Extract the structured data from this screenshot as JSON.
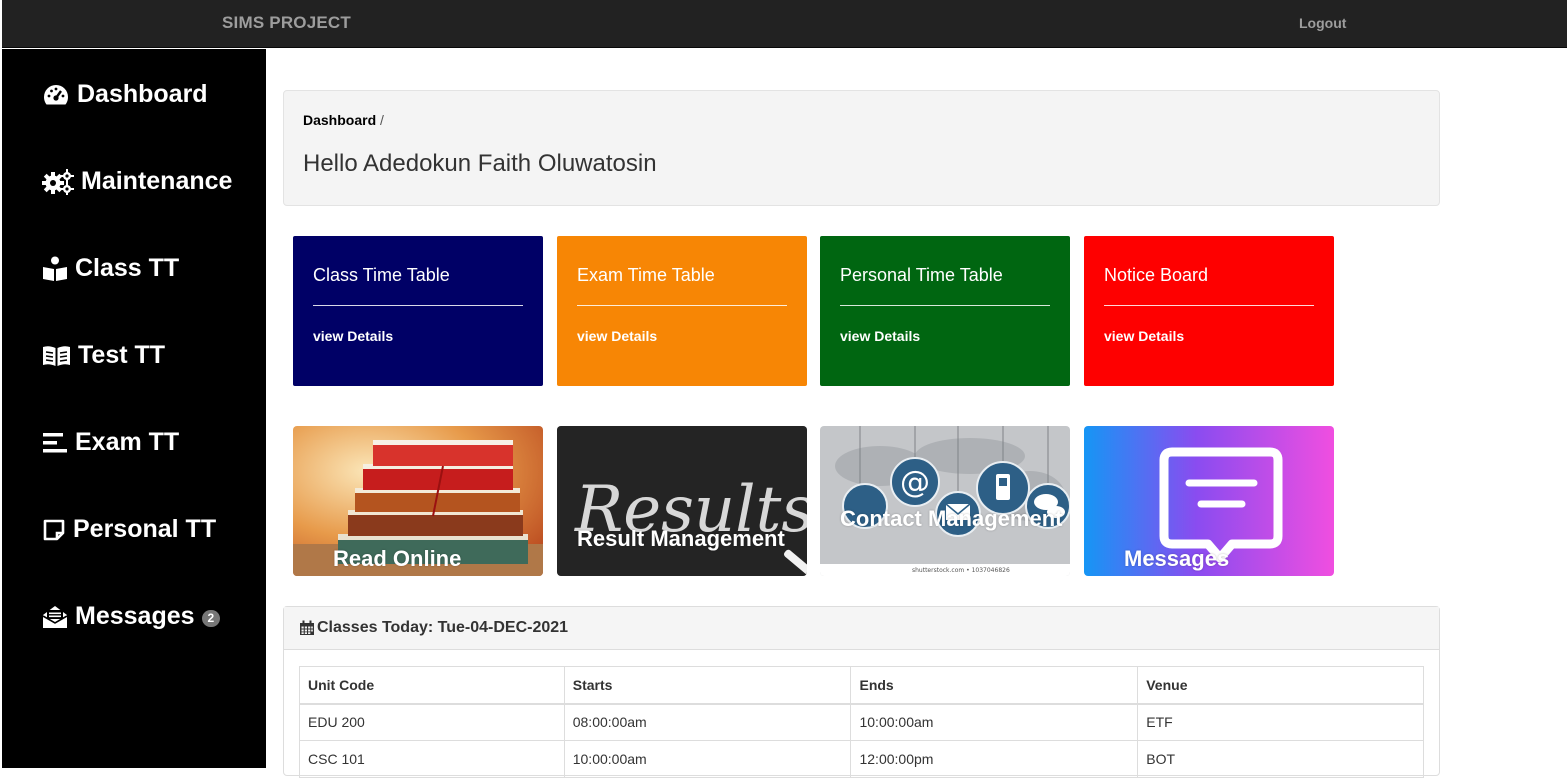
{
  "topbar": {
    "brand": "SIMS PROJECT",
    "logout": "Logout"
  },
  "sidebar": {
    "items": [
      {
        "label": "Dashboard",
        "icon": "dashboard-gauge-icon"
      },
      {
        "label": "Maintenance",
        "icon": "gears-icon"
      },
      {
        "label": "Class TT",
        "icon": "reader-icon"
      },
      {
        "label": "Test TT",
        "icon": "book-open-icon"
      },
      {
        "label": "Exam TT",
        "icon": "align-justify-icon"
      },
      {
        "label": "Personal TT",
        "icon": "sticky-note-icon"
      },
      {
        "label": "Messages",
        "icon": "envelope-open-icon",
        "badge": "2"
      }
    ]
  },
  "welcome": {
    "breadcrumb": "Dashboard",
    "separator": "/",
    "greeting": "Hello Adedokun Faith Oluwatosin"
  },
  "cards": [
    {
      "title": "Class Time Table",
      "link": "view Details",
      "color": "#000066"
    },
    {
      "title": "Exam Time Table",
      "link": "view Details",
      "color": "#f78605"
    },
    {
      "title": "Personal Time Table",
      "link": "view Details",
      "color": "#006611"
    },
    {
      "title": "Notice Board",
      "link": "view Details",
      "color": "#fe0000"
    }
  ],
  "tiles": [
    {
      "label": "Read Online"
    },
    {
      "label": "Result Management",
      "image_text": "Results"
    },
    {
      "label": "Contact Management",
      "image_text": "shutterstock.com • 1037046826"
    },
    {
      "label": "Messages"
    }
  ],
  "classes_panel": {
    "title": "Classes Today: Tue-04-DEC-2021",
    "columns": [
      "Unit Code",
      "Starts",
      "Ends",
      "Venue"
    ],
    "rows": [
      [
        "EDU 200",
        "08:00:00am",
        "10:00:00am",
        "ETF"
      ],
      [
        "CSC 101",
        "10:00:00am",
        "12:00:00pm",
        "BOT"
      ]
    ]
  }
}
